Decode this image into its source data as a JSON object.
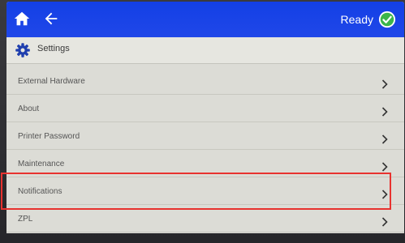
{
  "header": {
    "home_icon": "home-icon",
    "back_icon": "back-arrow-icon",
    "status_label": "Ready",
    "status_icon": "check-circle-icon",
    "bar_color": "#1a44e6",
    "status_icon_color": "#3bb54a"
  },
  "settings": {
    "icon": "gear-icon",
    "title": "Settings"
  },
  "menu": {
    "items": [
      {
        "label": "External Hardware"
      },
      {
        "label": "About"
      },
      {
        "label": "Printer Password"
      },
      {
        "label": "Maintenance"
      },
      {
        "label": "Notifications"
      },
      {
        "label": "ZPL"
      }
    ]
  },
  "annotation": {
    "highlighted_item": "Notifications",
    "highlight_color": "#e8322f"
  }
}
